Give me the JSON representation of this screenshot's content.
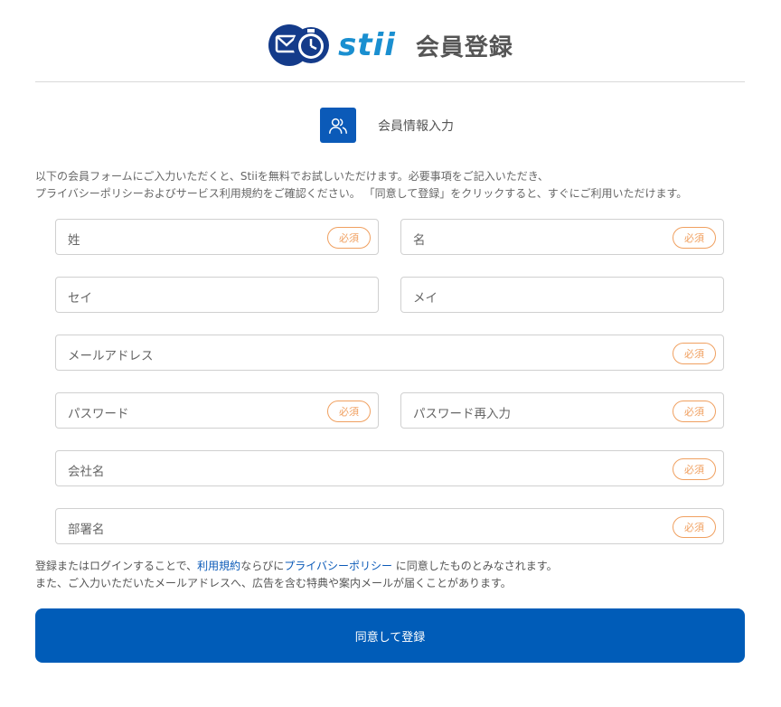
{
  "header": {
    "logo_text": "stii",
    "title": "会員登録"
  },
  "step": {
    "icon": "users-icon",
    "label": "会員情報入力"
  },
  "intro": {
    "line1": "以下の会員フォームにご入力いただくと、Stiiを無料でお試しいただけます。必要事項をご記入いただき、",
    "line2": "プライバシーポリシーおよびサービス利用規約をご確認ください。 「同意して登録」をクリックすると、すぐにご利用いただけます。"
  },
  "form": {
    "required_label": "必須",
    "last_name": "姓",
    "first_name": "名",
    "last_name_kana": "セイ",
    "first_name_kana": "メイ",
    "email": "メールアドレス",
    "password": "パスワード",
    "password_confirm": "パスワード再入力",
    "company": "会社名",
    "department": "部署名"
  },
  "terms": {
    "prefix": "登録またはログインすることで、",
    "link_terms": "利用規約",
    "middle": "ならびに",
    "link_privacy": "プライバシーポリシー",
    "suffix": " に同意したものとみなされます。",
    "line2": "また、ご入力いただいたメールアドレスへ、広告を含む特典や案内メールが届くことがあります。"
  },
  "submit_label": "同意して登録",
  "colors": {
    "primary": "#005cb8",
    "required": "#f0a060",
    "logo_text": "#1a8fd0"
  }
}
